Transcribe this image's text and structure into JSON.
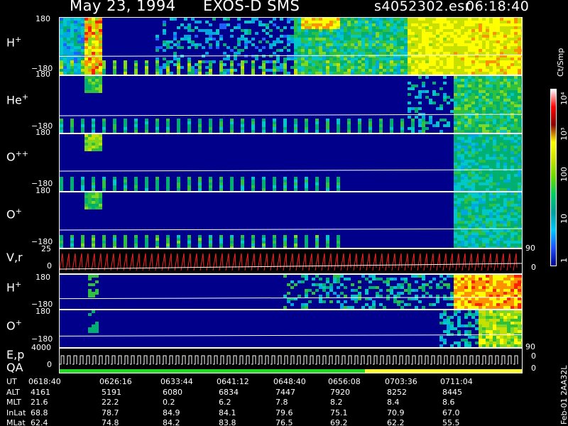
{
  "header": {
    "date": "May 23, 1994",
    "instrument": "EXOS-D SMS",
    "file": "s4052302.esr",
    "time": "06:18:40"
  },
  "colors": {
    "background": "#000000",
    "panel_background": "#00008b",
    "trace_red": "#ff2020",
    "trace_white": "#ffffff",
    "qa_green": "#22dd22",
    "qa_yellow": "#ffff33"
  },
  "panels": [
    {
      "label": "H",
      "sup": "+",
      "ymax": "180",
      "ymin": "−180"
    },
    {
      "label": "He",
      "sup": "+",
      "ymax": "180",
      "ymin": "−180"
    },
    {
      "label": "O",
      "sup": "++",
      "ymax": "180",
      "ymin": "−180"
    },
    {
      "label": "O",
      "sup": "+",
      "ymax": "180",
      "ymin": "−180"
    },
    {
      "label": "V,r",
      "sup": "",
      "ymax": "25",
      "ymin": "0",
      "right_max": "90",
      "right_min": "0"
    },
    {
      "label": "H",
      "sup": "+",
      "ymax": "180",
      "ymin": "−180"
    },
    {
      "label": "O",
      "sup": "+",
      "ymax": "180",
      "ymin": "−180"
    },
    {
      "label": "E,p",
      "label2": "QA",
      "ymax": "4000",
      "ymin": "0",
      "right_max": "90",
      "right_min": "0",
      "right_zero": "0"
    }
  ],
  "colorbar": {
    "title": "Ct/Smp",
    "labels": [
      "10⁴",
      "10³",
      "100",
      "10",
      "1"
    ],
    "stops": [
      "#ffffff",
      "#ff0000",
      "#8b0000",
      "#ffff00",
      "#c8e000",
      "#66dd00",
      "#00cc66",
      "#00a0a0",
      "#00c8ff",
      "#2050ff",
      "#00008b"
    ]
  },
  "footer": {
    "side_text": "Feb-01 2AA32L",
    "rows": [
      {
        "name": "UT",
        "values": [
          "0618:40",
          "0626:16",
          "0633:44",
          "0641:12",
          "0648:40",
          "0656:08",
          "0703:36",
          "0711:04"
        ]
      },
      {
        "name": "ALT",
        "values": [
          "4161",
          "5191",
          "6080",
          "6834",
          "7447",
          "7920",
          "8252",
          "8445"
        ]
      },
      {
        "name": "MLT",
        "values": [
          "21.6",
          "22.2",
          "0.2",
          "6.2",
          "7.8",
          "8.2",
          "8.4",
          "8.6"
        ]
      },
      {
        "name": "InLat",
        "values": [
          "68.8",
          "78.7",
          "84.9",
          "84.1",
          "79.6",
          "75.1",
          "70.9",
          "67.0"
        ]
      },
      {
        "name": "MLat",
        "values": [
          "62.4",
          "74.8",
          "84.2",
          "83.8",
          "76.5",
          "69.2",
          "62.2",
          "55.5"
        ]
      }
    ]
  },
  "chart_data": {
    "type": "heatmap",
    "x_ticks_ut": [
      "0618:40",
      "0626:16",
      "0633:44",
      "0641:12",
      "0648:40",
      "0656:08",
      "0703:36",
      "0711:04"
    ],
    "panels": [
      {
        "label": "H+",
        "y_range": [
          -180,
          180
        ],
        "unit": "Ct/Smp"
      },
      {
        "label": "He+",
        "y_range": [
          -180,
          180
        ],
        "unit": "Ct/Smp"
      },
      {
        "label": "O++",
        "y_range": [
          -180,
          180
        ],
        "unit": "Ct/Smp"
      },
      {
        "label": "O+",
        "y_range": [
          -180,
          180
        ],
        "unit": "Ct/Smp"
      },
      {
        "label": "V,r",
        "y_range": [
          0,
          25
        ],
        "right_range": [
          0,
          90
        ]
      },
      {
        "label": "H+",
        "y_range": [
          -180,
          180
        ],
        "unit": "Ct/Smp"
      },
      {
        "label": "O+",
        "y_range": [
          -180,
          180
        ],
        "unit": "Ct/Smp"
      },
      {
        "label": "E,p / QA",
        "y_range": [
          0,
          4000
        ],
        "right_range": [
          0,
          90
        ]
      }
    ],
    "colorbar": {
      "scale": "log",
      "range": [
        1,
        10000
      ],
      "unit": "Ct/Smp"
    }
  }
}
